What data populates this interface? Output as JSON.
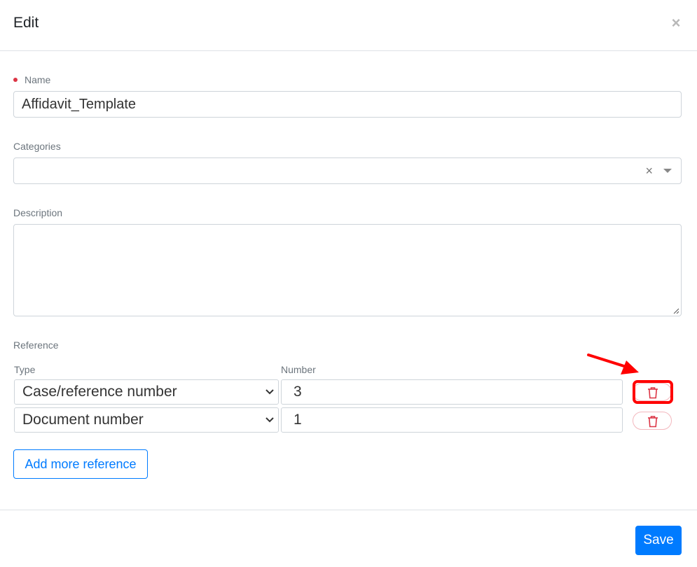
{
  "modal": {
    "title": "Edit",
    "close_glyph": "×"
  },
  "form": {
    "name": {
      "label": "Name",
      "value": "Affidavit_Template",
      "required": true
    },
    "categories": {
      "label": "Categories",
      "value": "",
      "clear_glyph": "×"
    },
    "description": {
      "label": "Description",
      "value": ""
    }
  },
  "reference": {
    "section_label": "Reference",
    "type_header": "Type",
    "number_header": "Number",
    "rows": [
      {
        "type": "Case/reference number",
        "number": "3"
      },
      {
        "type": "Document number",
        "number": "1"
      }
    ],
    "add_more_label": "Add more reference"
  },
  "footer": {
    "save_label": "Save"
  },
  "annotation": {
    "color": "#ff0000",
    "target": "delete-reference-row-1"
  },
  "colors": {
    "primary": "#007bff",
    "danger": "#dc3545",
    "border": "#ced4da",
    "label": "#6c757d"
  },
  "icons": {
    "close": "close-icon",
    "trash": "trash-icon",
    "dropdown": "chevron-down-icon"
  }
}
